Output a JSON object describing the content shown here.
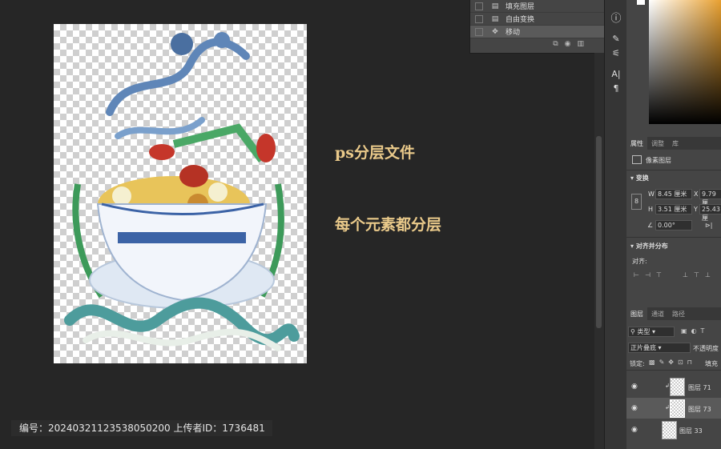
{
  "history": {
    "items": [
      {
        "label": "填充图层",
        "icon": "▤"
      },
      {
        "label": "自由变换",
        "icon": "▤"
      },
      {
        "label": "移动",
        "icon": "✥"
      }
    ]
  },
  "annotations": {
    "line1": "ps分层文件",
    "line2": "每个元素都分层"
  },
  "properties": {
    "tabs": [
      "属性",
      "调整",
      "库"
    ],
    "layer_type": "像素图层",
    "transform_title": "变换",
    "w_label": "W",
    "w_value": "8.45 厘米",
    "x_label": "X",
    "x_value": "9.79 厘",
    "h_label": "H",
    "h_value": "3.51 厘米",
    "y_label": "Y",
    "y_value": "25.43 厘",
    "angle_value": "0.00°",
    "align_title": "对齐并分布",
    "align_label": "对齐:"
  },
  "layers_panel": {
    "tabs": [
      "图层",
      "通道",
      "路径"
    ],
    "filter_label": "类型",
    "blend_mode": "正片叠底",
    "opacity_label": "不透明度",
    "lock_label": "锁定:",
    "fill_label": "填充",
    "layers": [
      {
        "name": "图层 71"
      },
      {
        "name": "图层 73"
      },
      {
        "name": "图层 33"
      }
    ]
  },
  "info_bar": {
    "text": "编号：20240321123538050200   上传者ID：1736481"
  },
  "colors": {
    "accent_gold": "#e9c98a",
    "panel": "#454545",
    "workspace": "#262626"
  }
}
